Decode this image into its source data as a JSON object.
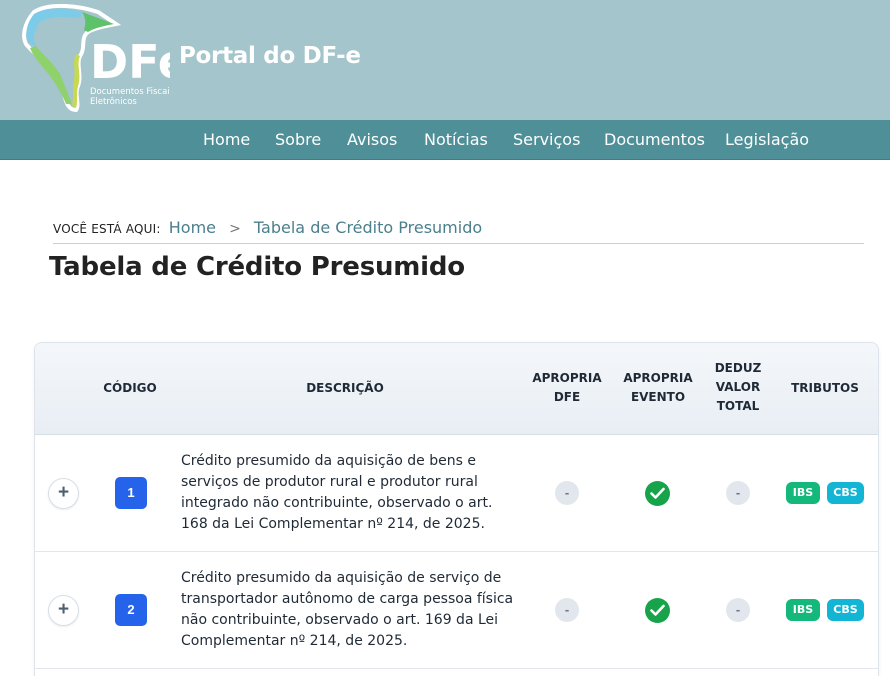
{
  "header": {
    "logo_text": "DFe",
    "logo_subtitle": "Documentos Fiscais Eletrônicos",
    "portal_title": "Portal do DF-e"
  },
  "nav": {
    "items": [
      {
        "label": "Home"
      },
      {
        "label": "Sobre"
      },
      {
        "label": "Avisos"
      },
      {
        "label": "Notícias"
      },
      {
        "label": "Serviços"
      },
      {
        "label": "Documentos"
      },
      {
        "label": "Legislação"
      }
    ]
  },
  "breadcrumb": {
    "prefix": "VOCÊ ESTÁ AQUI:",
    "home": "Home",
    "separator": ">",
    "current": "Tabela de Crédito Presumido"
  },
  "page": {
    "title": "Tabela de Crédito Presumido"
  },
  "table": {
    "headers": {
      "codigo": "CÓDIGO",
      "descricao": "DESCRIÇÃO",
      "apropria_dfe_1": "APROPRIA",
      "apropria_dfe_2": "DFE",
      "apropria_evento_1": "APROPRIA",
      "apropria_evento_2": "EVENTO",
      "deduz_1": "DEDUZ",
      "deduz_2": "VALOR",
      "deduz_3": "TOTAL",
      "tributos": "TRIBUTOS"
    },
    "rows": [
      {
        "expand": "+",
        "codigo": "1",
        "descricao": "Crédito presumido da aquisição de bens e serviços de produtor rural e produtor rural integrado não contribuinte, observado o art. 168 da Lei Complementar nº 214, de 2025.",
        "apropria_dfe": "-",
        "apropria_evento": "check",
        "deduz_valor_total": "-",
        "tributos": [
          "IBS",
          "CBS"
        ]
      },
      {
        "expand": "+",
        "codigo": "2",
        "descricao": "Crédito presumido da aquisição de serviço de transportador autônomo de carga pessoa física não contribuinte, observado o art. 169 da Lei Complementar nº 214, de 2025.",
        "apropria_dfe": "-",
        "apropria_evento": "check",
        "deduz_valor_total": "-",
        "tributos": [
          "IBS",
          "CBS"
        ]
      }
    ]
  },
  "colors": {
    "header_bg": "#a3c5cb",
    "nav_bg": "#4e8f98",
    "link": "#4a7f8c",
    "code_badge": "#2563eb",
    "check": "#16a34a",
    "ibs_tag": "#14b87a",
    "cbs_tag": "#12b5d4"
  }
}
